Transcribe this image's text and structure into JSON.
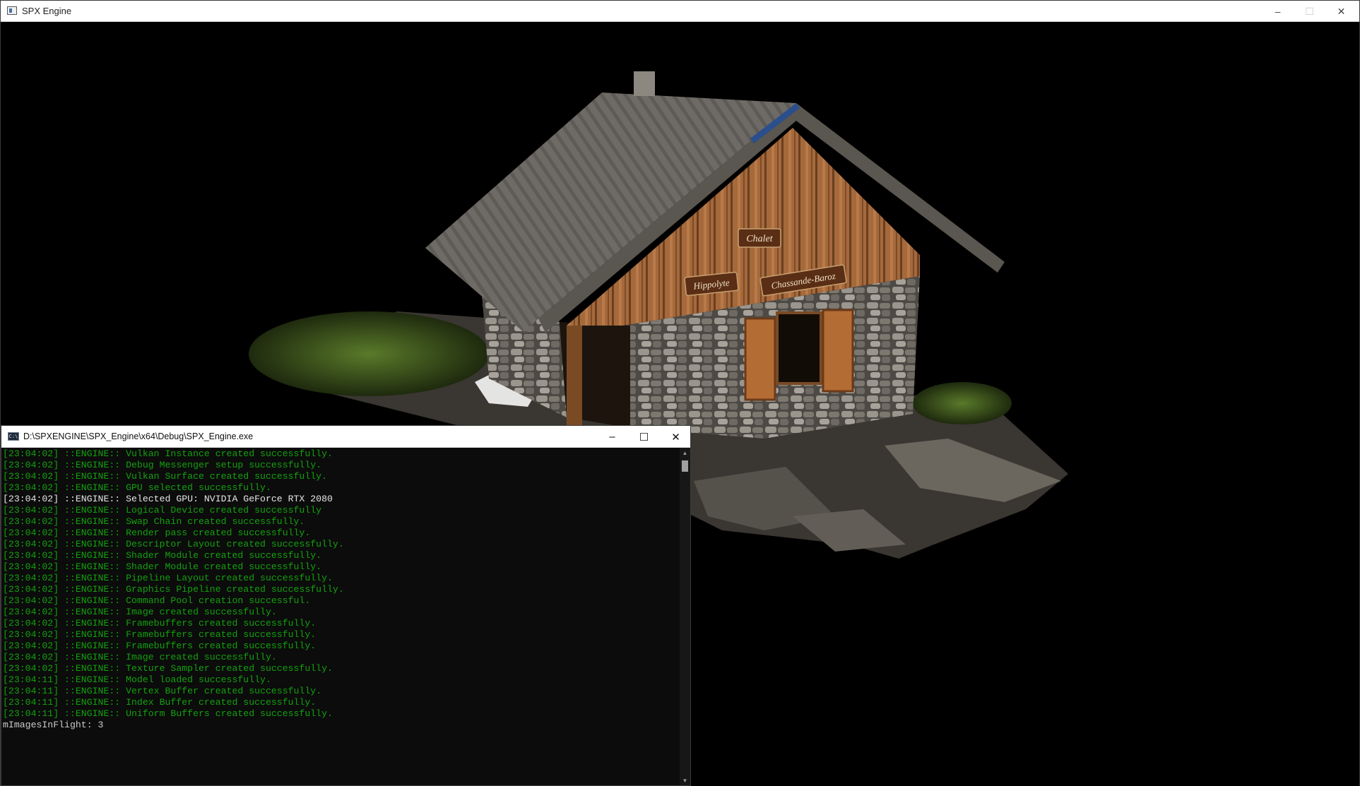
{
  "main_window": {
    "title": "SPX Engine",
    "controls": {
      "minimize": "–",
      "maximize": "☐",
      "close": "✕"
    }
  },
  "scene": {
    "sign_top": "Chalet",
    "sign_left": "Hippolyte",
    "sign_right": "Chassande-Baroz",
    "colors": {
      "background": "#000000",
      "roof": "#6f6a64",
      "wood": "#a0663a",
      "stone": "#8a8680"
    }
  },
  "console": {
    "title": "D:\\SPXENGINE\\SPX_Engine\\x64\\Debug\\SPX_Engine.exe",
    "icon_text": "C:\\",
    "controls": {
      "minimize": "–",
      "maximize": "☐",
      "close": "✕"
    },
    "colors": {
      "log": "#13a10e",
      "highlight": "#e6e6e6",
      "background": "#0c0c0c"
    },
    "lines": [
      {
        "text": "[23:04:02] ::ENGINE:: Vulkan Instance created successfully.",
        "white": false
      },
      {
        "text": "[23:04:02] ::ENGINE:: Debug Messenger setup successfully.",
        "white": false
      },
      {
        "text": "[23:04:02] ::ENGINE:: Vulkan Surface created successfully.",
        "white": false
      },
      {
        "text": "[23:04:02] ::ENGINE:: GPU selected successfully.",
        "white": false
      },
      {
        "text": "[23:04:02] ::ENGINE:: Selected GPU: NVIDIA GeForce RTX 2080",
        "white": true
      },
      {
        "text": "[23:04:02] ::ENGINE:: Logical Device created successfully",
        "white": false
      },
      {
        "text": "[23:04:02] ::ENGINE:: Swap Chain created successfully.",
        "white": false
      },
      {
        "text": "[23:04:02] ::ENGINE:: Render pass created successfully.",
        "white": false
      },
      {
        "text": "[23:04:02] ::ENGINE:: Descriptor Layout created successfully.",
        "white": false
      },
      {
        "text": "[23:04:02] ::ENGINE:: Shader Module created successfully.",
        "white": false
      },
      {
        "text": "[23:04:02] ::ENGINE:: Shader Module created successfully.",
        "white": false
      },
      {
        "text": "[23:04:02] ::ENGINE:: Pipeline Layout created successfully.",
        "white": false
      },
      {
        "text": "[23:04:02] ::ENGINE:: Graphics Pipeline created successfully.",
        "white": false
      },
      {
        "text": "[23:04:02] ::ENGINE:: Command Pool creation successful.",
        "white": false
      },
      {
        "text": "[23:04:02] ::ENGINE:: Image created successfully.",
        "white": false
      },
      {
        "text": "[23:04:02] ::ENGINE:: Framebuffers created successfully.",
        "white": false
      },
      {
        "text": "[23:04:02] ::ENGINE:: Framebuffers created successfully.",
        "white": false
      },
      {
        "text": "[23:04:02] ::ENGINE:: Framebuffers created successfully.",
        "white": false
      },
      {
        "text": "[23:04:02] ::ENGINE:: Image created successfully.",
        "white": false
      },
      {
        "text": "[23:04:02] ::ENGINE:: Texture Sampler created successfully.",
        "white": false
      },
      {
        "text": "[23:04:11] ::ENGINE:: Model loaded successfully.",
        "white": false
      },
      {
        "text": "[23:04:11] ::ENGINE:: Vertex Buffer created successfully.",
        "white": false
      },
      {
        "text": "[23:04:11] ::ENGINE:: Index Buffer created successfully.",
        "white": false
      },
      {
        "text": "[23:04:11] ::ENGINE:: Uniform Buffers created successfully.",
        "white": false
      }
    ],
    "prompt": "mImagesInFlight: 3",
    "scroll_up": "▲",
    "scroll_down": "▼"
  }
}
